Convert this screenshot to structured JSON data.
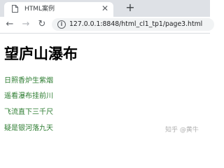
{
  "browser": {
    "tab": {
      "title": "HTML案例",
      "close_glyph": "✕",
      "favicon": "document-icon"
    },
    "new_tab_glyph": "+",
    "nav": {
      "back_glyph": "←",
      "forward_glyph": "→",
      "reload_glyph": "↻",
      "info_glyph": "i"
    },
    "address_bar": {
      "url": "127.0.0.1:8848/html_cl1_tp1/page3.html"
    }
  },
  "page": {
    "title": "望庐山瀑布",
    "lines": [
      "日照香炉生紫烟",
      "遥看瀑布挂前川",
      "飞流直下三千尺",
      "疑是银河落九天"
    ]
  },
  "watermark": "知乎 @黄牛",
  "colors": {
    "tabstrip": "#dee1e6",
    "omnibox": "#f1f3f4",
    "poem_text": "#2e7d32",
    "title_text": "#000000"
  }
}
